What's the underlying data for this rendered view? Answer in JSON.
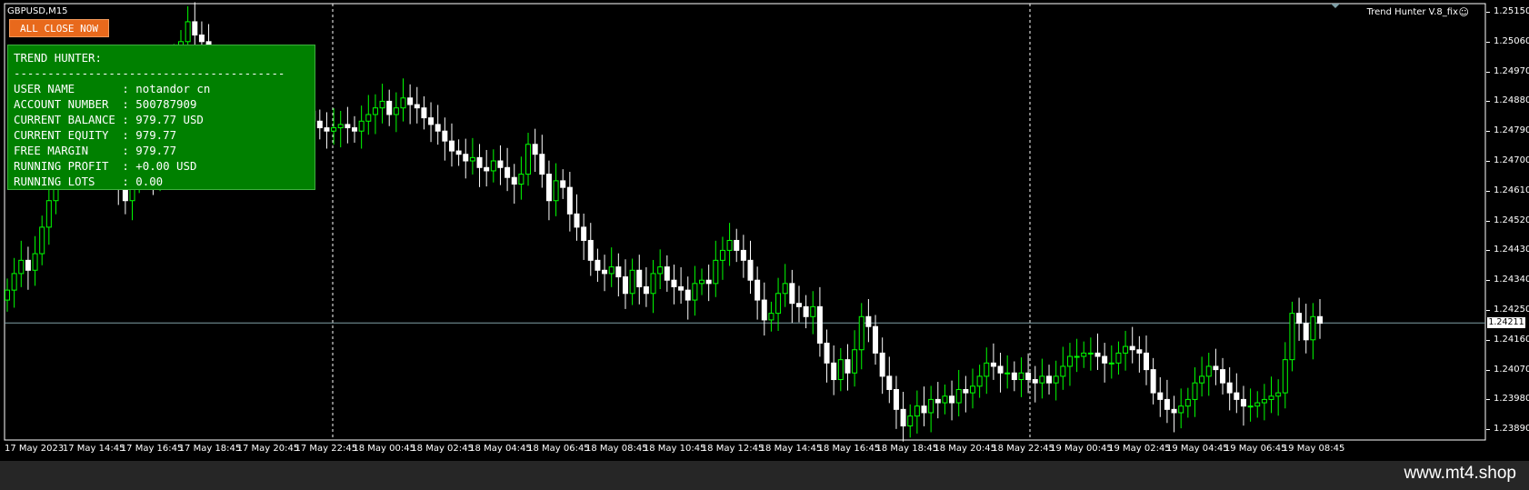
{
  "window": {
    "symbol_title": "GBPUSD,M15",
    "indicator_name": "Trend Hunter V.8_fix",
    "smile_icon": "smile-icon",
    "button_label": "ALL CLOSE NOW"
  },
  "panel": {
    "rows": [
      "TREND HUNTER:",
      "----------------------------------------",
      "USER NAME       : notandor cn",
      "ACCOUNT NUMBER  : 500787909",
      "CURRENT BALANCE : 979.77 USD",
      "CURRENT EQUITY  : 979.77",
      "FREE MARGIN     : 979.77",
      "RUNNING PROFIT  : +0.00 USD",
      "RUNNING LOTS    : 0.00"
    ]
  },
  "price_axis": {
    "labels": [
      "1.25150",
      "1.25060",
      "1.24970",
      "1.24880",
      "1.24790",
      "1.24700",
      "1.24610",
      "1.24520",
      "1.24430",
      "1.24340",
      "1.24250",
      "1.24160",
      "1.24070",
      "1.23980",
      "1.23890"
    ],
    "current_bid": "1.24211"
  },
  "time_axis": {
    "labels": [
      "17 May 2023",
      "17 May 14:45",
      "17 May 16:45",
      "17 May 18:45",
      "17 May 20:45",
      "17 May 22:45",
      "18 May 00:45",
      "18 May 02:45",
      "18 May 04:45",
      "18 May 06:45",
      "18 May 08:45",
      "18 May 10:45",
      "18 May 12:45",
      "18 May 14:45",
      "18 May 16:45",
      "18 May 18:45",
      "18 May 20:45",
      "18 May 22:45",
      "19 May 00:45",
      "19 May 02:45",
      "19 May 04:45",
      "19 May 06:45",
      "19 May 08:45"
    ]
  },
  "footer": {
    "site": "www.mt4.shop"
  },
  "colors": {
    "bull": "#00ff00",
    "bear": "#ffffff",
    "panel": "#008000",
    "button": "#e8691c",
    "bid_line": "#7f9fa6"
  },
  "chart_data": {
    "type": "candlestick",
    "symbol": "GBPUSD",
    "timeframe": "M15",
    "closes": [
      1.2431,
      1.2436,
      1.244,
      1.2437,
      1.2442,
      1.245,
      1.2458,
      1.2468,
      1.2475,
      1.2472,
      1.2478,
      1.247,
      1.2474,
      1.2478,
      1.248,
      1.247,
      1.2462,
      1.2458,
      1.2465,
      1.247,
      1.2472,
      1.2465,
      1.248,
      1.2494,
      1.25,
      1.2506,
      1.2512,
      1.2508,
      1.2506,
      1.2498,
      1.2494,
      1.249,
      1.2485,
      1.2487,
      1.2484,
      1.2487,
      1.2485,
      1.2486,
      1.2488,
      1.2487,
      1.2486,
      1.2489,
      1.2488,
      1.2485,
      1.2482,
      1.248,
      1.2479,
      1.248,
      1.2481,
      1.248,
      1.2479,
      1.2482,
      1.2484,
      1.2486,
      1.2488,
      1.2484,
      1.2486,
      1.2489,
      1.2487,
      1.2486,
      1.2483,
      1.2481,
      1.2479,
      1.2476,
      1.2473,
      1.2472,
      1.247,
      1.2471,
      1.2468,
      1.2467,
      1.247,
      1.2468,
      1.2465,
      1.2463,
      1.2466,
      1.2475,
      1.2472,
      1.2466,
      1.2458,
      1.2464,
      1.2462,
      1.2454,
      1.245,
      1.2446,
      1.244,
      1.2437,
      1.2436,
      1.2438,
      1.2435,
      1.243,
      1.2437,
      1.2432,
      1.243,
      1.2436,
      1.2438,
      1.2434,
      1.2432,
      1.2431,
      1.2428,
      1.2433,
      1.2434,
      1.2433,
      1.244,
      1.2443,
      1.2446,
      1.2443,
      1.244,
      1.2434,
      1.2428,
      1.2422,
      1.2424,
      1.243,
      1.2433,
      1.2427,
      1.2426,
      1.2423,
      1.2426,
      1.2415,
      1.2409,
      1.2404,
      1.241,
      1.2406,
      1.2413,
      1.2423,
      1.242,
      1.2412,
      1.2405,
      1.2401,
      1.2395,
      1.239,
      1.2393,
      1.2396,
      1.2394,
      1.2398,
      1.2397,
      1.2399,
      1.2397,
      1.2401,
      1.24,
      1.2402,
      1.2405,
      1.2409,
      1.2408,
      1.2406,
      1.2406,
      1.2404,
      1.2406,
      1.2404,
      1.2403,
      1.2405,
      1.2403,
      1.2405,
      1.2408,
      1.2411,
      1.2411,
      1.2412,
      1.2412,
      1.2411,
      1.2409,
      1.2409,
      1.2412,
      1.2414,
      1.2413,
      1.2412,
      1.2407,
      1.24,
      1.2398,
      1.2395,
      1.2394,
      1.2396,
      1.2398,
      1.2403,
      1.2405,
      1.2408,
      1.2407,
      1.2403,
      1.24,
      1.2398,
      1.2396,
      1.2396,
      1.2397,
      1.2398,
      1.2399,
      1.24,
      1.241,
      1.2424,
      1.2421,
      1.2416,
      1.2423,
      1.2421
    ],
    "opens_note_omitted": true,
    "price_axis_range": [
      1.2389,
      1.2515
    ],
    "current_bid": 1.24211,
    "grid": false,
    "vertical_separators": [
      "17 May 22:45",
      "18 May 22:45"
    ]
  }
}
